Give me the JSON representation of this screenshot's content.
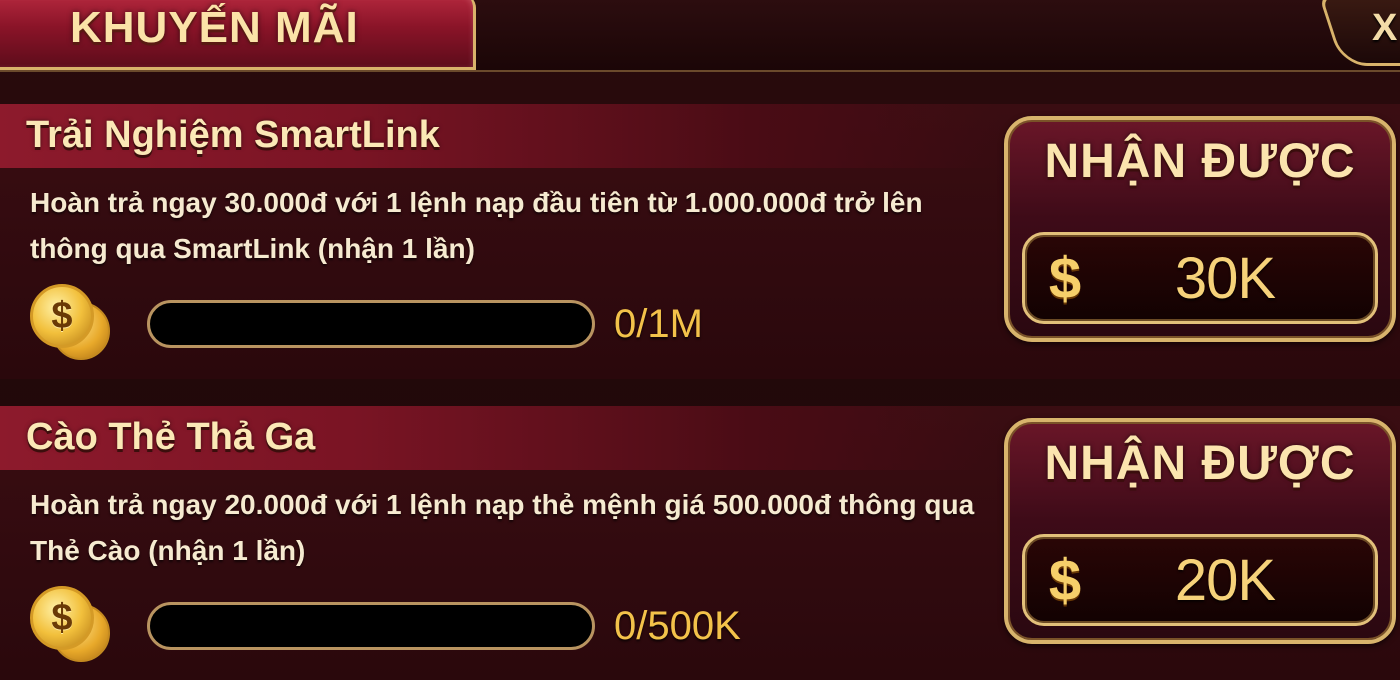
{
  "header": {
    "title": "KHUYẾN MÃI",
    "close_symbol": "X"
  },
  "promotions": [
    {
      "title": "Trải Nghiệm SmartLink",
      "description": "Hoàn trả ngay 30.000đ với 1 lệnh nạp đầu tiên từ 1.000.000đ trở lên thông qua SmartLink (nhận 1 lần)",
      "progress_text": "0/1M",
      "progress_fraction": 0,
      "reward_label": "NHẬN ĐƯỢC",
      "reward_amount": "30K",
      "coin_symbol": "$",
      "currency_symbol": "$"
    },
    {
      "title": "Cào Thẻ Thả Ga",
      "description": "Hoàn trả ngay 20.000đ với 1 lệnh nạp thẻ mệnh giá 500.000đ thông qua Thẻ Cào (nhận 1 lần)",
      "progress_text": "0/500K",
      "progress_fraction": 0,
      "reward_label": "NHẬN ĐƯỢC",
      "reward_amount": "20K",
      "coin_symbol": "$",
      "currency_symbol": "$"
    }
  ],
  "icons": {
    "close": "close-icon",
    "coin": "coin-stack-icon",
    "currency": "dollar-icon"
  },
  "colors": {
    "accent_gold": "#d8b46c",
    "title_cream": "#fbe4ae",
    "progress_text": "#f3c24a",
    "band_red": "#8d1a2c"
  }
}
